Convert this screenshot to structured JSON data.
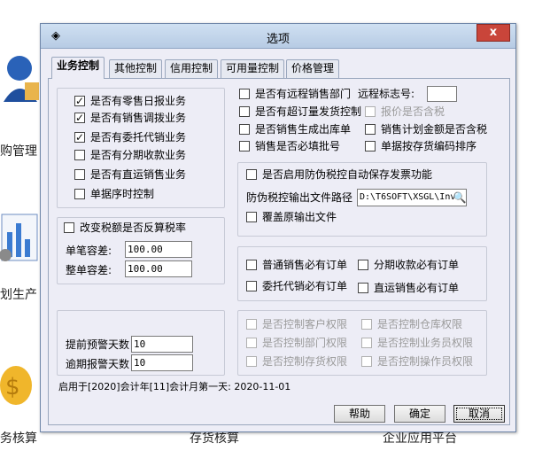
{
  "background": {
    "labels": [
      "购管理",
      "划生产",
      "务核算",
      "存货核算",
      "企业应用平台"
    ]
  },
  "dialog": {
    "title": "选项",
    "close_label": "x",
    "tabs": [
      "业务控制",
      "其他控制",
      "信用控制",
      "可用量控制",
      "价格管理"
    ],
    "active_tab": "业务控制",
    "left_group": {
      "items": [
        {
          "label": "是否有零售日报业务",
          "checked": true
        },
        {
          "label": "是否有销售调拨业务",
          "checked": true
        },
        {
          "label": "是否有委托代销业务",
          "checked": true
        },
        {
          "label": "是否有分期收款业务",
          "checked": false
        },
        {
          "label": "是否有直运销售业务",
          "checked": false
        },
        {
          "label": "单据序时控制",
          "checked": false
        }
      ]
    },
    "tax_group": {
      "checkbox": "改变税额是否反算税率",
      "single_tolerance_label": "单笔容差:",
      "single_tolerance_value": "100.00",
      "whole_tolerance_label": "整单容差:",
      "whole_tolerance_value": "100.00"
    },
    "warn_group": {
      "advance_label": "提前预警天数",
      "advance_value": "10",
      "overdue_label": "逾期报警天数",
      "overdue_value": "10"
    },
    "right_group": {
      "remote_dept": "是否有远程销售部门",
      "remote_mark_label": "远程标志号:",
      "remote_mark_value": "",
      "overorder": "是否有超订量发货控制",
      "quote_tax": "报价是否含税",
      "gen_outbound": "是否销售生成出库单",
      "plan_amount_tax": "销售计划金额是否含税",
      "batch_required": "销售是否必填批号",
      "sort_by_code": "单据按存货编码排序"
    },
    "tax_control_group": {
      "auto_save": "是否启用防伪税控自动保存发票功能",
      "path_label": "防伪税控输出文件路径",
      "path_value": "D:\\T6SOFT\\XSGL\\Inv",
      "overwrite": "覆盖原输出文件"
    },
    "order_group": {
      "normal_order": "普通销售必有订单",
      "installment_order": "分期收款必有订单",
      "consign_order": "委托代销必有订单",
      "direct_order": "直运销售必有订单"
    },
    "permission_group": {
      "customer": "是否控制客户权限",
      "warehouse": "是否控制仓库权限",
      "department": "是否控制部门权限",
      "salesman": "是否控制业务员权限",
      "inventory": "是否控制存货权限",
      "operator": "是否控制操作员权限"
    },
    "status_text": "启用于[2020]会计年[11]会计月第一天: 2020-11-01",
    "buttons": {
      "help": "帮助",
      "ok": "确定",
      "cancel": "取消"
    }
  }
}
